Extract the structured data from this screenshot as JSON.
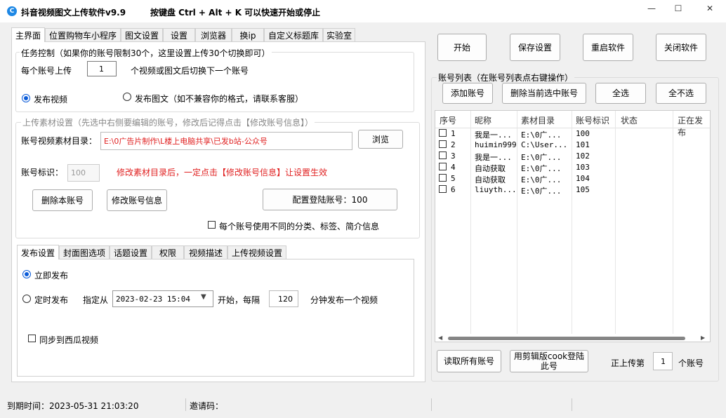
{
  "titlebar": {
    "app_title": "抖音视频图文上传软件v9.9",
    "hotkey_hint": "按键盘 Ctrl + Alt + K  可以快速开始或停止",
    "minimize": "—",
    "maximize": "☐",
    "close": "✕"
  },
  "main_tabs": [
    "主界面",
    "位置购物车小程序",
    "图文设置",
    "设置",
    "浏览器",
    "换ip",
    "自定义标题库",
    "实验室"
  ],
  "task": {
    "title": "任务控制（如果你的账号限制30个，这里设置上传30个切换即可）",
    "per_account_label": "每个账号上传",
    "per_account_value": "1",
    "per_account_suffix": "个视频或图文后切换下一个账号",
    "radio_video": "发布视频",
    "radio_image": "发布图文（如不兼容你的格式，请联系客服）"
  },
  "material": {
    "title": "上传素材设置（先选中右侧要编辑的账号，修改后记得点击【修改账号信息】）",
    "dir_label": "账号视频素材目录：",
    "dir_value": "E:\\0广告片制作\\L楼上电脑共享\\已发b站-公众号",
    "browse": "浏览",
    "id_label": "账号标识：",
    "id_placeholder": "100",
    "warning": "修改素材目录后，一定点击【修改账号信息】让设置生效",
    "delete_btn": "删除本账号",
    "modify_btn": "修改账号信息",
    "config_btn": "配置登陆账号：100",
    "diff_check": "每个账号使用不同的分类、标签、简介信息"
  },
  "publish_tabs": [
    "发布设置",
    "封面图选项",
    "话题设置",
    "权限",
    "视频描述",
    "上传视频设置"
  ],
  "publish": {
    "immediate": "立即发布",
    "scheduled": "定时发布",
    "from_label": "指定从",
    "datetime": "2023-02-23 15:04",
    "start_label": "开始，每隔",
    "interval": "120",
    "interval_suffix": "分钟发布一个视频",
    "xigua": "同步到西瓜视频"
  },
  "top_buttons": [
    "开始",
    "保存设置",
    "重启软件",
    "关闭软件"
  ],
  "accounts": {
    "title": "账号列表（在账号列表点右键操作）",
    "add": "添加账号",
    "delete_selected": "删除当前选中账号",
    "select_all": "全选",
    "select_none": "全不选",
    "columns": [
      "序号",
      "昵称",
      "素材目录",
      "账号标识",
      "状态",
      "正在发布"
    ],
    "rows": [
      [
        "1",
        "我是一...",
        "E:\\0广...",
        "100"
      ],
      [
        "2",
        "huimin999",
        "C:\\User...",
        "101"
      ],
      [
        "3",
        "我是一...",
        "E:\\0广...",
        "102"
      ],
      [
        "4",
        "自动获取",
        "E:\\0广...",
        "103"
      ],
      [
        "5",
        "自动获取",
        "E:\\0广...",
        "104"
      ],
      [
        "6",
        "liuyth...",
        "E:\\0广...",
        "105"
      ]
    ],
    "read_all": "读取所有账号",
    "cookie_login": "用剪辑版cook登陆此号",
    "uploading_label": "正上传第",
    "uploading_value": "1",
    "uploading_suffix": "个账号"
  },
  "status": {
    "expiry": "到期时间：2023-05-31 21:03:20",
    "invite": "邀请码："
  }
}
